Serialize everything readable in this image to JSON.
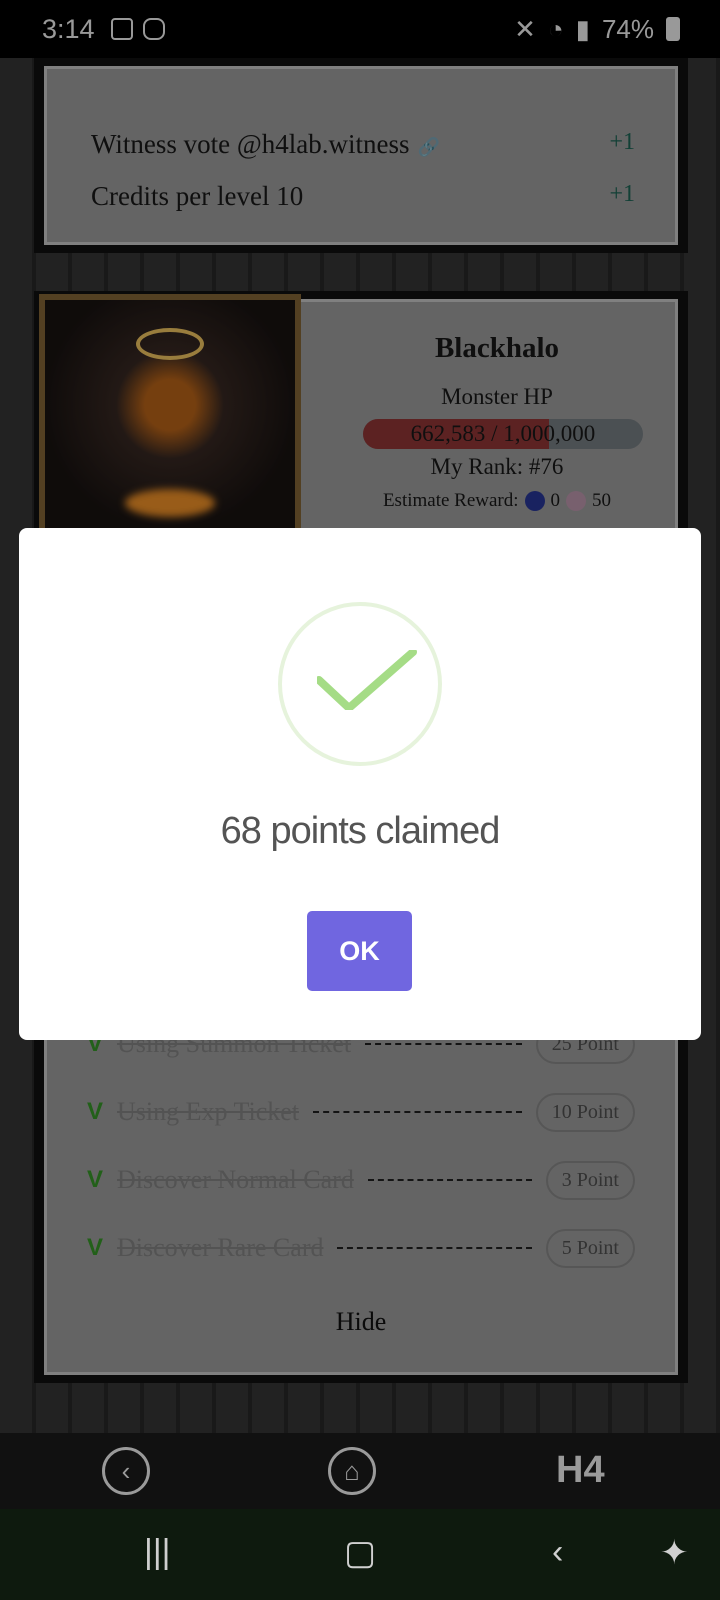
{
  "status_bar": {
    "time": "3:14",
    "battery": "74%"
  },
  "top_panel": {
    "rows": [
      {
        "label": "Witness vote @h4lab.witness",
        "value": "+1"
      },
      {
        "label": "Credits per level 10",
        "value": "+1"
      }
    ]
  },
  "boss": {
    "name": "Blackhalo",
    "hp_label": "Monster HP",
    "hp_text": "662,583 / 1,000,000",
    "hp_fraction": 0.662583,
    "rank": "My Rank: #76",
    "estimate_label": "Estimate Reward:",
    "estimate_a": "0",
    "estimate_b": "50"
  },
  "tasks": [
    {
      "label": "Using Summon Ticket",
      "points": "25 Point"
    },
    {
      "label": "Using Exp Ticket",
      "points": "10 Point"
    },
    {
      "label": "Discover Normal Card",
      "points": "3 Point"
    },
    {
      "label": "Discover Rare Card",
      "points": "5 Point"
    }
  ],
  "check_mark": "V",
  "hide_label": "Hide",
  "modal": {
    "title": "68 points claimed",
    "ok_label": "OK"
  },
  "app_nav": {
    "logo": "H4"
  },
  "colors": {
    "accent": "#7066e0",
    "success": "#a5dc86"
  }
}
